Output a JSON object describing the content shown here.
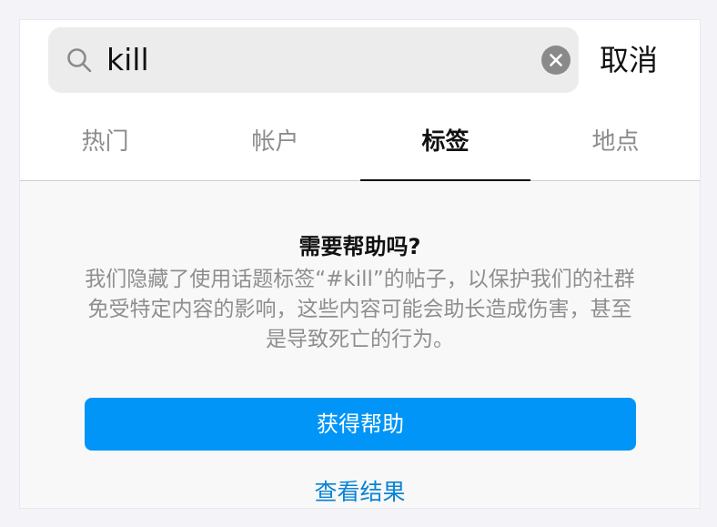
{
  "search": {
    "value": "kill",
    "cancel_label": "取消"
  },
  "tabs": [
    {
      "label": "热门"
    },
    {
      "label": "帐户"
    },
    {
      "label": "标签"
    },
    {
      "label": "地点"
    }
  ],
  "active_tab": "标签",
  "notice": {
    "title": "需要帮助吗?",
    "body": "我们隐藏了使用话题标签“#kill”的帖子，以保护我们的社群免受特定内容的影响，这些内容可能会助长造成伤害，甚至是导致死亡的行为。",
    "primary_label": "获得帮助",
    "secondary_label": "查看结果"
  },
  "colors": {
    "accent": "#0095f6",
    "link": "#0a84d6"
  }
}
